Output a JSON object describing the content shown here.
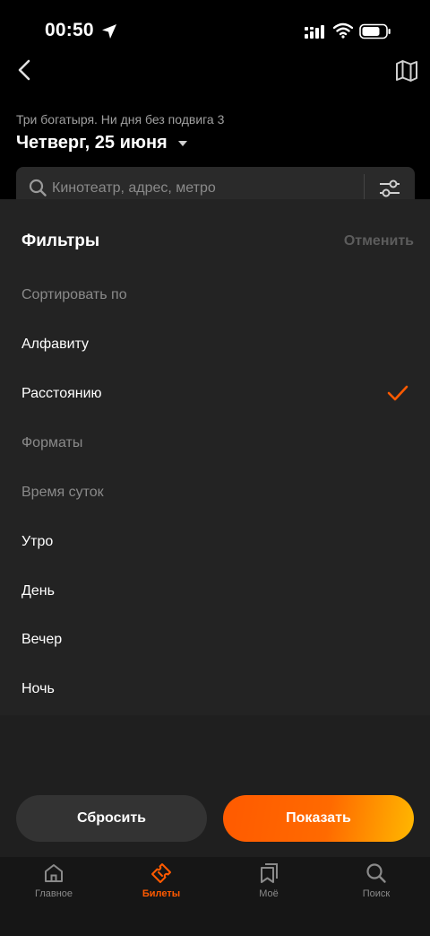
{
  "status_bar": {
    "time": "00:50"
  },
  "header": {
    "movie_title": "Три богатыря. Ни дня без подвига 3",
    "date_label": "Четверг, 25 июня"
  },
  "search": {
    "placeholder": "Кинотеатр, адрес, метро",
    "value": ""
  },
  "filters_sheet": {
    "title": "Фильтры",
    "cancel_label": "Отменить",
    "sort_section": "Сортировать по",
    "sort_options": [
      {
        "label": "Алфавиту",
        "selected": false
      },
      {
        "label": "Расстоянию",
        "selected": true
      }
    ],
    "formats_section": "Форматы",
    "time_section": "Время суток",
    "time_options": [
      {
        "label": "Утро"
      },
      {
        "label": "День"
      },
      {
        "label": "Вечер"
      },
      {
        "label": "Ночь"
      }
    ],
    "reset_label": "Сбросить",
    "show_label": "Показать"
  },
  "tab_bar": {
    "tabs": [
      {
        "label": "Главное",
        "icon": "home-icon",
        "active": false
      },
      {
        "label": "Билеты",
        "icon": "ticket-icon",
        "active": true
      },
      {
        "label": "Моё",
        "icon": "bookmarks-icon",
        "active": false
      },
      {
        "label": "Поиск",
        "icon": "search-icon",
        "active": false
      }
    ]
  },
  "colors": {
    "accent": "#ff5a00",
    "accent_gradient_end": "#ffb800",
    "sheet_bg": "#232323",
    "muted_text": "#8a8a8a",
    "background": "#000000"
  }
}
